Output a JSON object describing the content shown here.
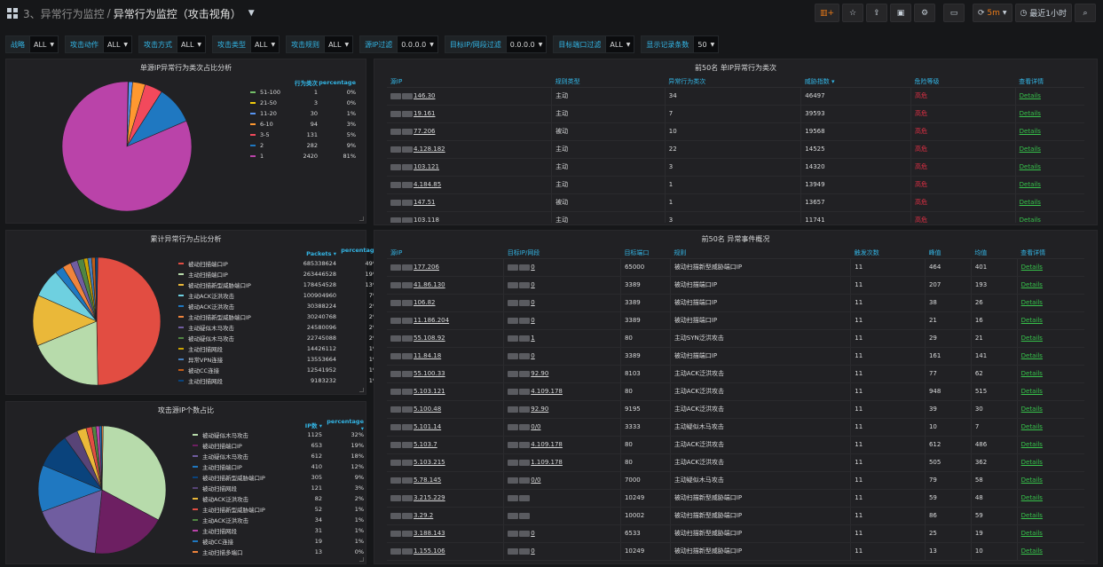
{
  "header": {
    "folder": "3、异常行为监控",
    "separator": "/",
    "title": "异常行为监控（攻击视角）",
    "refresh_interval": "5m",
    "time_range": "最近1小时"
  },
  "filters": [
    {
      "label": "战略",
      "value": "ALL"
    },
    {
      "label": "攻击动作",
      "value": "ALL"
    },
    {
      "label": "攻击方式",
      "value": "ALL"
    },
    {
      "label": "攻击类型",
      "value": "ALL"
    },
    {
      "label": "攻击规则",
      "value": "ALL"
    },
    {
      "label": "源IP过滤",
      "value": "0.0.0.0"
    },
    {
      "label": "目标IP/网段过滤",
      "value": "0.0.0.0"
    },
    {
      "label": "目标端口过滤",
      "value": "ALL"
    },
    {
      "label": "显示记录条数",
      "value": "50"
    }
  ],
  "pie1": {
    "title": "单源IP异常行为类次占比分析",
    "col1": "",
    "col2": "行为类次",
    "col3": "percentage",
    "items": [
      {
        "label": "51-100",
        "value": "1",
        "pct": "0%",
        "color": "#73bf69"
      },
      {
        "label": "21-50",
        "value": "3",
        "pct": "0%",
        "color": "#f2cc0c"
      },
      {
        "label": "11-20",
        "value": "30",
        "pct": "1%",
        "color": "#5794f2"
      },
      {
        "label": "6-10",
        "value": "94",
        "pct": "3%",
        "color": "#ff9830"
      },
      {
        "label": "3-5",
        "value": "131",
        "pct": "5%",
        "color": "#f2495c"
      },
      {
        "label": "2",
        "value": "282",
        "pct": "9%",
        "color": "#1f78c1"
      },
      {
        "label": "1",
        "value": "2420",
        "pct": "81%",
        "color": "#ba43a9"
      }
    ]
  },
  "pie2": {
    "title": "累计异常行为占比分析",
    "col1": "",
    "col2": "Packets ▾",
    "col3": "percentage ▾",
    "items": [
      {
        "label": "被动扫描端口IP",
        "value": "685338624",
        "pct": "49%",
        "color": "#e24d42"
      },
      {
        "label": "主动扫描端口IP",
        "value": "263446528",
        "pct": "19%",
        "color": "#b7dbab"
      },
      {
        "label": "被动扫描新型威胁端口IP",
        "value": "178454528",
        "pct": "13%",
        "color": "#eab839"
      },
      {
        "label": "主动ACK泛洪攻击",
        "value": "100904960",
        "pct": "7%",
        "color": "#6ed0e0"
      },
      {
        "label": "被动ACK泛洪攻击",
        "value": "30388224",
        "pct": "2%",
        "color": "#1f78c1"
      },
      {
        "label": "主动扫描新型威胁端口IP",
        "value": "30240768",
        "pct": "2%",
        "color": "#ef843c"
      },
      {
        "label": "主动疑似木马攻击",
        "value": "24580096",
        "pct": "2%",
        "color": "#705da0"
      },
      {
        "label": "被动疑似木马攻击",
        "value": "22745088",
        "pct": "2%",
        "color": "#508642"
      },
      {
        "label": "主动扫描网段",
        "value": "14426112",
        "pct": "1%",
        "color": "#cca300"
      },
      {
        "label": "异常VPN连接",
        "value": "13553664",
        "pct": "1%",
        "color": "#447ebc"
      },
      {
        "label": "被动CC连接",
        "value": "12541952",
        "pct": "1%",
        "color": "#c15c17"
      },
      {
        "label": "主动扫描网段",
        "value": "9183232",
        "pct": "1%",
        "color": "#0a437c"
      }
    ]
  },
  "pie3": {
    "title": "攻击源IP个数占比",
    "col1": "",
    "col2": "IP数 ▾",
    "col3": "percentage ▾",
    "items": [
      {
        "label": "被动疑似木马攻击",
        "value": "1125",
        "pct": "32%",
        "color": "#b7dbab"
      },
      {
        "label": "被动扫描端口IP",
        "value": "653",
        "pith": "",
        "pct": "19%",
        "color": "#6d1f62"
      },
      {
        "label": "主动疑似木马攻击",
        "value": "612",
        "pct": "18%",
        "color": "#705da0"
      },
      {
        "label": "主动扫描端口IP",
        "value": "410",
        "pct": "12%",
        "color": "#1f78c1"
      },
      {
        "label": "被动扫描新型威胁端口IP",
        "value": "305",
        "pct": "9%",
        "color": "#0a437c"
      },
      {
        "label": "被动扫描网段",
        "value": "121",
        "pct": "3%",
        "color": "#584477"
      },
      {
        "label": "被动ACK泛洪攻击",
        "value": "82",
        "pct": "2%",
        "color": "#eab839"
      },
      {
        "label": "主动扫描新型威胁端口IP",
        "value": "52",
        "pct": "1%",
        "color": "#e24d42"
      },
      {
        "label": "主动ACK泛洪攻击",
        "value": "34",
        "pct": "1%",
        "color": "#508642"
      },
      {
        "label": "主动扫描网段",
        "value": "31",
        "pct": "1%",
        "color": "#ba43a9"
      },
      {
        "label": "被动CC连接",
        "value": "19",
        "pct": "1%",
        "color": "#1f78c1"
      },
      {
        "label": "主动扫描多端口",
        "value": "13",
        "pct": "0%",
        "color": "#ef843c"
      }
    ]
  },
  "table1": {
    "title": "前50名 单IP异常行为类次",
    "columns": [
      "源IP",
      "规则类型",
      "异常行为类次",
      "威胁指数 ▾",
      "危险等级",
      "查看详情"
    ],
    "rows": [
      [
        "146.30",
        "主动",
        "34",
        "46497",
        "高危",
        "Details"
      ],
      [
        "19.161",
        "主动",
        "7",
        "39593",
        "高危",
        "Details"
      ],
      [
        "77.206",
        "被动",
        "10",
        "19568",
        "高危",
        "Details"
      ],
      [
        "4.128.182",
        "主动",
        "22",
        "14525",
        "高危",
        "Details"
      ],
      [
        "103.121",
        "主动",
        "3",
        "14320",
        "高危",
        "Details"
      ],
      [
        "4.184.85",
        "主动",
        "1",
        "13949",
        "高危",
        "Details"
      ],
      [
        "147.51",
        "被动",
        "1",
        "13657",
        "高危",
        "Details"
      ],
      [
        "103.118",
        "主动",
        "3",
        "11741",
        "高危",
        "Details"
      ]
    ]
  },
  "table2": {
    "title": "前50名 异常事件概况",
    "columns": [
      "源IP",
      "目标IP/网段",
      "目标端口",
      "规则",
      "触发次数",
      "峰值",
      "均值",
      "查看详情"
    ],
    "rows": [
      [
        "177.206",
        "0",
        "65000",
        "被动扫描新型威胁端口IP",
        "11",
        "464",
        "401",
        "Details"
      ],
      [
        "41.86.130",
        "0",
        "3389",
        "被动扫描端口IP",
        "11",
        "207",
        "193",
        "Details"
      ],
      [
        "106.82",
        "0",
        "3389",
        "被动扫描端口IP",
        "11",
        "38",
        "26",
        "Details"
      ],
      [
        "11.186.204",
        "0",
        "3389",
        "被动扫描端口IP",
        "11",
        "21",
        "16",
        "Details"
      ],
      [
        "55.108.92",
        "1",
        "80",
        "主动SYN泛洪攻击",
        "11",
        "29",
        "21",
        "Details"
      ],
      [
        "11.84.18",
        "0",
        "3389",
        "被动扫描端口IP",
        "11",
        "161",
        "141",
        "Details"
      ],
      [
        "55.100.33",
        "92.90",
        "8103",
        "主动ACK泛洪攻击",
        "11",
        "77",
        "62",
        "Details"
      ],
      [
        "5.103.121",
        "4.109.178",
        "80",
        "主动ACK泛洪攻击",
        "11",
        "948",
        "515",
        "Details"
      ],
      [
        "5.100.48",
        "92.90",
        "9195",
        "主动ACK泛洪攻击",
        "11",
        "39",
        "30",
        "Details"
      ],
      [
        "5.101.14",
        "0/0",
        "3333",
        "主动疑似木马攻击",
        "11",
        "10",
        "7",
        "Details"
      ],
      [
        "5.103.7",
        "4.109.178",
        "80",
        "主动ACK泛洪攻击",
        "11",
        "612",
        "486",
        "Details"
      ],
      [
        "5.103.215",
        "1.109.178",
        "80",
        "主动ACK泛洪攻击",
        "11",
        "505",
        "362",
        "Details"
      ],
      [
        "5.78.145",
        "0/0",
        "7000",
        "主动疑似木马攻击",
        "11",
        "79",
        "58",
        "Details"
      ],
      [
        "3.215.229",
        "",
        "10249",
        "被动扫描新型威胁端口IP",
        "11",
        "59",
        "48",
        "Details"
      ],
      [
        "3.29.2",
        "",
        "10002",
        "被动扫描新型威胁端口IP",
        "11",
        "86",
        "59",
        "Details"
      ],
      [
        "3.188.143",
        "0",
        "6533",
        "被动扫描新型威胁端口IP",
        "11",
        "25",
        "19",
        "Details"
      ],
      [
        "1.155.106",
        "0",
        "10249",
        "被动扫描新型威胁端口IP",
        "11",
        "13",
        "10",
        "Details"
      ]
    ]
  }
}
